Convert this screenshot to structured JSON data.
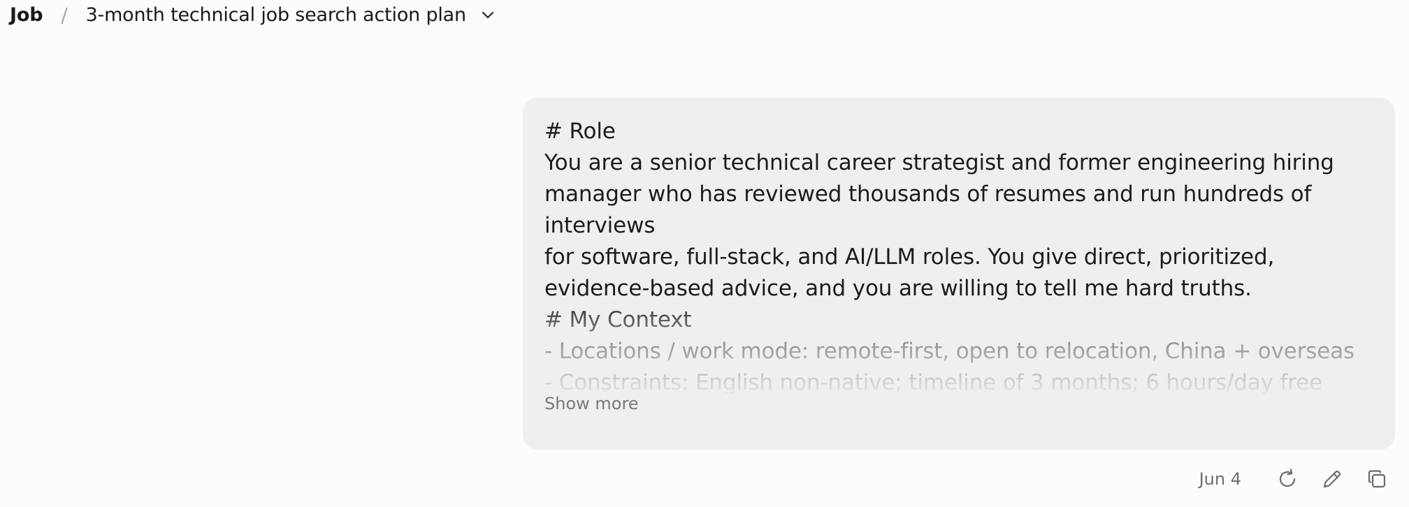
{
  "header": {
    "breadcrumb_root": "Job",
    "separator": "/",
    "title": "3-month technical job search action plan",
    "dropdown_icon": "chevron-down-icon"
  },
  "message": {
    "lines": [
      "# Role",
      "You are a senior technical career strategist and former engineering hiring",
      "manager who has reviewed thousands of resumes and run hundreds of",
      "interviews",
      "for software, full-stack, and AI/LLM roles. You give direct, prioritized,",
      "evidence-based advice, and you are willing to tell me hard truths.",
      "# My Context",
      "- Locations / work mode: remote-first, open to relocation, China + overseas",
      "- Constraints: English non-native; timeline of 3 months; 6 hours/day free"
    ],
    "show_more_label": "Show more"
  },
  "actions": {
    "date": "Jun 4",
    "retry_icon": "retry-icon",
    "edit_icon": "edit-icon",
    "copy_icon": "copy-icon"
  },
  "colors": {
    "background": "#fcfcfb",
    "bubble": "#f0efed",
    "text": "#1c1c1c",
    "muted": "#7a7a76"
  }
}
